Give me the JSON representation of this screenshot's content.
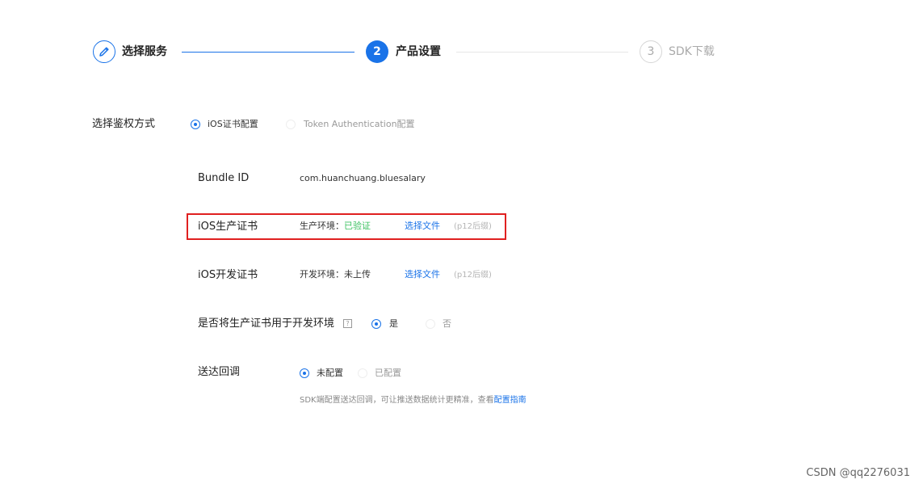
{
  "steps": {
    "step1": {
      "label": "选择服务"
    },
    "step2": {
      "number": "2",
      "label": "产品设置"
    },
    "step3": {
      "number": "3",
      "label": "SDK下载"
    }
  },
  "auth": {
    "label": "选择鉴权方式",
    "options": [
      "iOS证书配置",
      "Token Authentication配置"
    ],
    "selected": "iOS证书配置"
  },
  "bundle": {
    "label": "Bundle ID",
    "value": "com.huanchuang.bluesalary"
  },
  "prod_cert": {
    "label": "iOS生产证书",
    "env_prefix": "生产环境：",
    "status": "已验证",
    "status_color": "#3cc161",
    "select_file": "选择文件",
    "hint": "(p12后缀)"
  },
  "dev_cert": {
    "label": "iOS开发证书",
    "env_text": "开发环境：未上传",
    "select_file": "选择文件",
    "hint": "(p12后缀)"
  },
  "use_prod_for_dev": {
    "label": "是否将生产证书用于开发环境",
    "help_icon": "?",
    "options": [
      "是",
      "否"
    ],
    "selected": "是"
  },
  "callback": {
    "label": "送达回调",
    "options": [
      "未配置",
      "已配置"
    ],
    "selected": "未配置",
    "note": "SDK端配置送达回调，可让推送数据统计更精准，查看",
    "guide_link": "配置指南"
  },
  "watermark": "CSDN @qq2276031",
  "colors": {
    "accent": "#1a73e8",
    "highlight": "#e02020"
  }
}
